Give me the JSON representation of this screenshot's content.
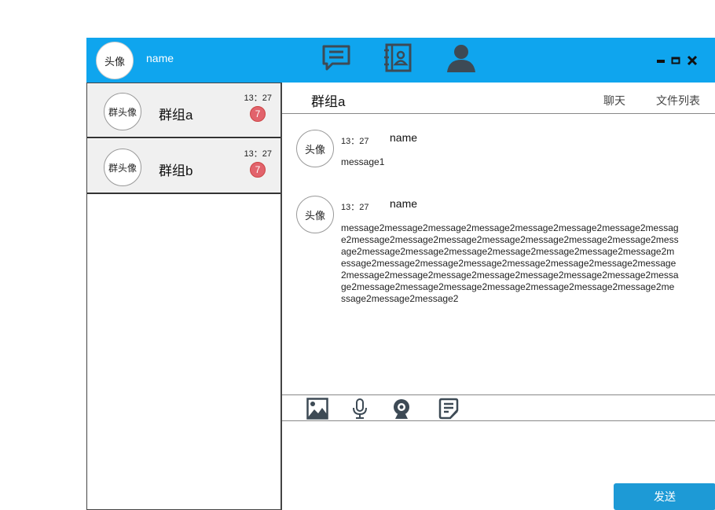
{
  "user": {
    "avatar_label": "头像",
    "name": "name"
  },
  "top_nav": {
    "icons": [
      "chat-icon",
      "contacts-icon",
      "user-icon"
    ]
  },
  "window_controls": [
    "minimize-icon",
    "maximize-icon",
    "close-icon"
  ],
  "groups": [
    {
      "avatar_label": "群头像",
      "name": "群组a",
      "time": "13：27",
      "unread": "7"
    },
    {
      "avatar_label": "群头像",
      "name": "群组b",
      "time": "13：27",
      "unread": "7"
    }
  ],
  "chat": {
    "title": "群组a",
    "tabs": [
      "聊天",
      "文件列表"
    ],
    "messages": [
      {
        "avatar_label": "头像",
        "time": "13：27",
        "name": "name",
        "text": "message1"
      },
      {
        "avatar_label": "头像",
        "time": "13：27",
        "name": "name",
        "text": "message2message2message2message2message2message2message2message2message2message2message2message2message2message2message2message2message2message2message2message2message2message2message2message2message2message2message2message2message2message2message2message2message2message2message2message2message2message2message2message2message2message2message2message2message2message2message2message2message2"
      }
    ],
    "tools": [
      "image-icon",
      "microphone-icon",
      "webcam-icon",
      "notes-icon"
    ],
    "send_label": "发送"
  },
  "colors": {
    "topbar": "#0fa5ee",
    "badge": "#e2636c",
    "send_button": "#1d9ad6",
    "icon_dark": "#3d4a55"
  }
}
